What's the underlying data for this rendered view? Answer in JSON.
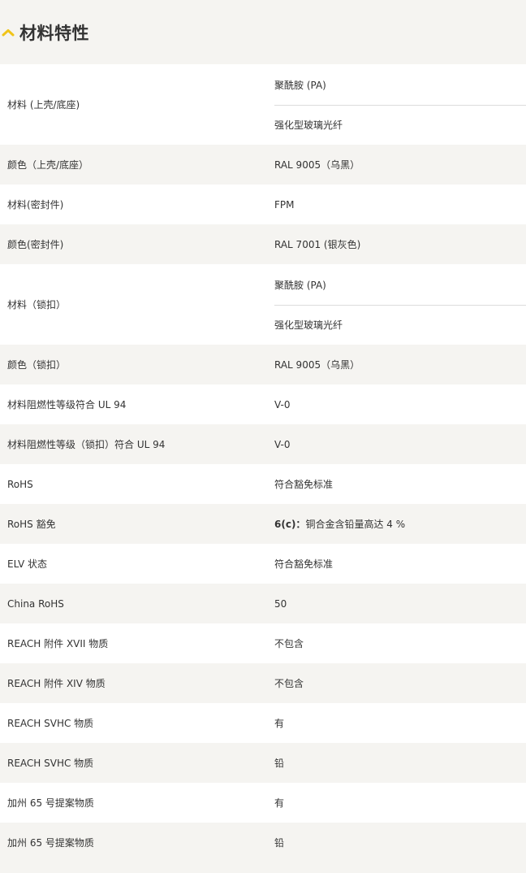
{
  "section": {
    "title": "材料特性",
    "accent_color": "#f0c419"
  },
  "rows": [
    {
      "label": "材料 (上壳/底座)",
      "values": [
        "聚酰胺 (PA)",
        "强化型玻璃光纤"
      ]
    },
    {
      "label": "颜色（上壳/底座）",
      "values": [
        "RAL 9005（乌黑）"
      ]
    },
    {
      "label": "材料(密封件)",
      "values": [
        "FPM"
      ]
    },
    {
      "label": "颜色(密封件)",
      "values": [
        "RAL 7001 (银灰色)"
      ]
    },
    {
      "label": "材料（锁扣）",
      "values": [
        "聚酰胺 (PA)",
        "强化型玻璃光纤"
      ]
    },
    {
      "label": "颜色（锁扣）",
      "values": [
        "RAL 9005（乌黑）"
      ]
    },
    {
      "label": "材料阻燃性等级符合 UL 94",
      "values": [
        "V-0"
      ]
    },
    {
      "label": "材料阻燃性等级（锁扣）符合 UL 94",
      "values": [
        "V-0"
      ]
    },
    {
      "label": "RoHS",
      "values": [
        "符合豁免标准"
      ]
    },
    {
      "label": "RoHS 豁免",
      "value_bold": "6(c)：",
      "values": [
        "铜合金含铅量高达 4 %"
      ]
    },
    {
      "label": "ELV 状态",
      "values": [
        "符合豁免标准"
      ]
    },
    {
      "label": "China RoHS",
      "values": [
        "50"
      ]
    },
    {
      "label": "REACH 附件 XVII 物质",
      "values": [
        "不包含"
      ]
    },
    {
      "label": "REACH 附件 XIV 物质",
      "values": [
        "不包含"
      ]
    },
    {
      "label": "REACH SVHC 物质",
      "values": [
        "有"
      ]
    },
    {
      "label": "REACH SVHC 物质",
      "values": [
        "铅"
      ]
    },
    {
      "label": "加州 65 号提案物质",
      "values": [
        "有"
      ]
    },
    {
      "label": "加州 65 号提案物质",
      "values": [
        "铅"
      ]
    }
  ]
}
